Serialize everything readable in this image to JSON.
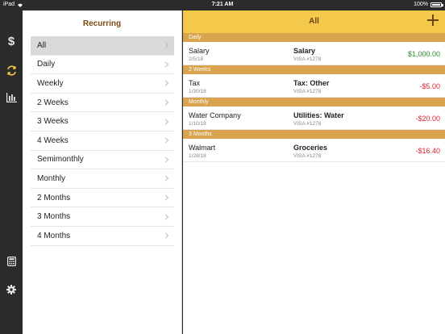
{
  "status": {
    "device": "iPad",
    "time": "7:21 AM",
    "battery": "100%"
  },
  "icons": [
    {
      "name": "dollar-icon",
      "label": "Transactions"
    },
    {
      "name": "recurring-icon",
      "label": "Recurring"
    },
    {
      "name": "reports-icon",
      "label": "Reports"
    },
    {
      "name": "calculator-icon",
      "label": "Calculator"
    },
    {
      "name": "settings-icon",
      "label": "Settings"
    }
  ],
  "colors": {
    "accent": "#f4c84a",
    "section": "#d9a34f",
    "positive": "#2a8a2a",
    "negative": "#d8262b",
    "active_icon": "#f4c84a"
  },
  "master": {
    "title": "Recurring",
    "items": [
      {
        "label": "All",
        "selected": true
      },
      {
        "label": "Daily"
      },
      {
        "label": "Weekly"
      },
      {
        "label": "2 Weeks"
      },
      {
        "label": "3 Weeks"
      },
      {
        "label": "4 Weeks"
      },
      {
        "label": "Semimonthly"
      },
      {
        "label": "Monthly"
      },
      {
        "label": "2 Months"
      },
      {
        "label": "3 Months"
      },
      {
        "label": "4 Months"
      }
    ]
  },
  "detail": {
    "title": "All",
    "sections": [
      {
        "header": "Daily",
        "rows": [
          {
            "payee": "Salary",
            "date": "2/5/18",
            "category": "Salary",
            "account": "VISA #1278",
            "amount": "$1,000.00",
            "sign": "pos"
          }
        ]
      },
      {
        "header": "2 Weeks",
        "rows": [
          {
            "payee": "Tax",
            "date": "1/30/18",
            "category": "Tax: Other",
            "account": "VISA #1278",
            "amount": "-$5.00",
            "sign": "neg"
          }
        ]
      },
      {
        "header": "Monthly",
        "rows": [
          {
            "payee": "Water Company",
            "date": "1/10/18",
            "category": "Utilities: Water",
            "account": "VISA #1278",
            "amount": "-$20.00",
            "sign": "neg"
          }
        ]
      },
      {
        "header": "3 Months",
        "rows": [
          {
            "payee": "Walmart",
            "date": "1/28/18",
            "category": "Groceries",
            "account": "VISA #1278",
            "amount": "-$16.40",
            "sign": "neg"
          }
        ]
      }
    ]
  }
}
